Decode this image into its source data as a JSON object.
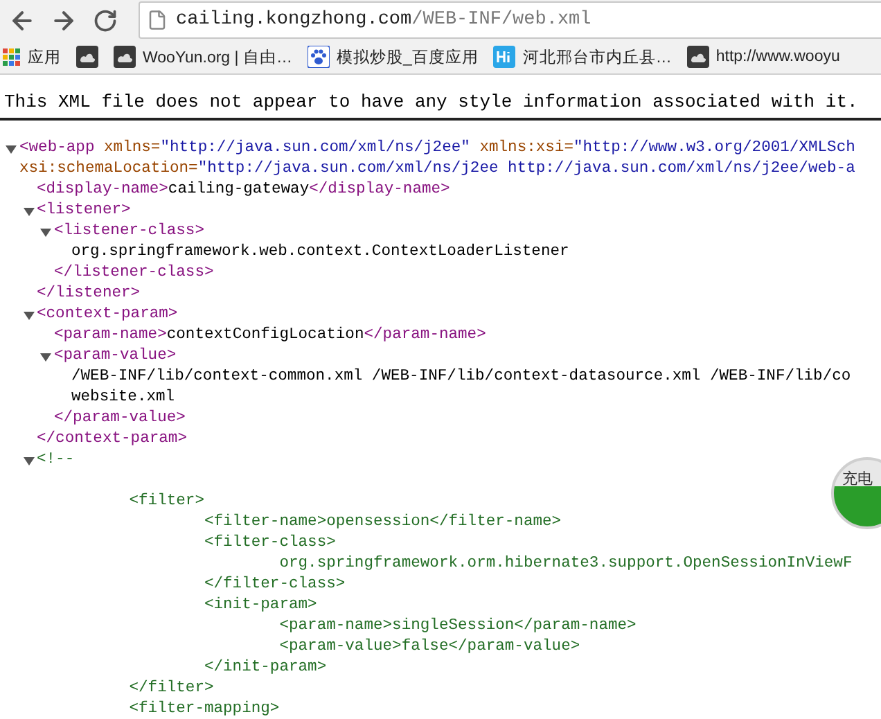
{
  "address_bar": {
    "host": "cailing.kongzhong.com",
    "path": "/WEB-INF/web.xml"
  },
  "bookmarks": [
    {
      "kind": "apps",
      "label": "应用"
    },
    {
      "kind": "site"
    },
    {
      "kind": "site",
      "label": "WooYun.org | 自由…"
    },
    {
      "kind": "paw",
      "label": "模拟炒股_百度应用"
    },
    {
      "kind": "hi",
      "label": "河北邢台市内丘县…"
    },
    {
      "kind": "site",
      "label": "http://www.wooyu"
    }
  ],
  "notice": "This XML file does not appear to have any style information associated with it.",
  "xml": [
    {
      "kind": "element",
      "expanded": true,
      "open": [
        [
          {
            "kind": "tag",
            "text": "<web-app "
          },
          {
            "kind": "attr",
            "text": "xmlns="
          },
          {
            "kind": "value",
            "text": "\"http://java.sun.com/xml/ns/j2ee\" "
          },
          {
            "kind": "attr",
            "text": "xmlns:xsi="
          },
          {
            "kind": "value",
            "text": "\"http://www.w3.org/2001/XMLSch"
          }
        ],
        [
          {
            "kind": "attr",
            "text": "xsi:schemaLocation="
          },
          {
            "kind": "value",
            "text": "\"http://java.sun.com/xml/ns/j2ee http://java.sun.com/xml/ns/j2ee/web-a"
          }
        ]
      ],
      "children": [
        {
          "kind": "line",
          "rows": [
            [
              {
                "kind": "tag",
                "text": "<display-name>"
              },
              {
                "kind": "text",
                "text": "cailing-gateway"
              },
              {
                "kind": "tag",
                "text": "</display-name>"
              }
            ]
          ]
        },
        {
          "kind": "element",
          "expanded": true,
          "open": [
            [
              {
                "kind": "tag",
                "text": "<listener>"
              }
            ]
          ],
          "children": [
            {
              "kind": "element",
              "expanded": true,
              "open": [
                [
                  {
                    "kind": "tag",
                    "text": "<listener-class>"
                  }
                ]
              ],
              "children": [
                {
                  "kind": "line",
                  "rows": [
                    [
                      {
                        "kind": "text",
                        "text": "org.springframework.web.context.ContextLoaderListener"
                      }
                    ]
                  ]
                }
              ],
              "close": [
                {
                  "kind": "tag",
                  "text": "</listener-class>"
                }
              ]
            }
          ],
          "close": [
            {
              "kind": "tag",
              "text": "</listener>"
            }
          ]
        },
        {
          "kind": "element",
          "expanded": true,
          "open": [
            [
              {
                "kind": "tag",
                "text": "<context-param>"
              }
            ]
          ],
          "children": [
            {
              "kind": "line",
              "rows": [
                [
                  {
                    "kind": "tag",
                    "text": "<param-name>"
                  },
                  {
                    "kind": "text",
                    "text": "contextConfigLocation"
                  },
                  {
                    "kind": "tag",
                    "text": "</param-name>"
                  }
                ]
              ]
            },
            {
              "kind": "element",
              "expanded": true,
              "open": [
                [
                  {
                    "kind": "tag",
                    "text": "<param-value>"
                  }
                ]
              ],
              "children": [
                {
                  "kind": "line",
                  "rows": [
                    [
                      {
                        "kind": "text",
                        "text": "/WEB-INF/lib/context-common.xml /WEB-INF/lib/context-datasource.xml /WEB-INF/lib/co"
                      }
                    ],
                    [
                      {
                        "kind": "text",
                        "text": "website.xml"
                      }
                    ]
                  ]
                }
              ],
              "close": [
                {
                  "kind": "tag",
                  "text": "</param-value>"
                }
              ]
            }
          ],
          "close": [
            {
              "kind": "tag",
              "text": "</context-param>"
            }
          ]
        },
        {
          "kind": "comment",
          "expanded": true,
          "open": [
            [
              {
                "kind": "comment",
                "text": "<!--"
              }
            ]
          ],
          "children": [
            {
              "kind": "line",
              "rows": [
                [
                  {
                    "kind": "comment",
                    "text": "\t<filter>"
                  }
                ]
              ]
            },
            {
              "kind": "line",
              "rows": [
                [
                  {
                    "kind": "comment",
                    "text": "\t\t<filter-name>opensession</filter-name>"
                  }
                ]
              ]
            },
            {
              "kind": "line",
              "rows": [
                [
                  {
                    "kind": "comment",
                    "text": "\t\t<filter-class>"
                  }
                ]
              ]
            },
            {
              "kind": "line",
              "rows": [
                [
                  {
                    "kind": "comment",
                    "text": "\t\t\torg.springframework.orm.hibernate3.support.OpenSessionInViewF"
                  }
                ]
              ]
            },
            {
              "kind": "line",
              "rows": [
                [
                  {
                    "kind": "comment",
                    "text": "\t\t</filter-class>"
                  }
                ]
              ]
            },
            {
              "kind": "line",
              "rows": [
                [
                  {
                    "kind": "comment",
                    "text": "\t\t<init-param>"
                  }
                ]
              ]
            },
            {
              "kind": "line",
              "rows": [
                [
                  {
                    "kind": "comment",
                    "text": "\t\t\t<param-name>singleSession</param-name>"
                  }
                ]
              ]
            },
            {
              "kind": "line",
              "rows": [
                [
                  {
                    "kind": "comment",
                    "text": "\t\t\t<param-value>false</param-value>"
                  }
                ]
              ]
            },
            {
              "kind": "line",
              "rows": [
                [
                  {
                    "kind": "comment",
                    "text": "\t\t</init-param>"
                  }
                ]
              ]
            },
            {
              "kind": "line",
              "rows": [
                [
                  {
                    "kind": "comment",
                    "text": "\t</filter>"
                  }
                ]
              ]
            },
            {
              "kind": "line",
              "rows": [
                [
                  {
                    "kind": "comment",
                    "text": "\t<filter-mapping>"
                  }
                ]
              ]
            }
          ]
        }
      ]
    }
  ],
  "widget": {
    "label": "充电"
  }
}
